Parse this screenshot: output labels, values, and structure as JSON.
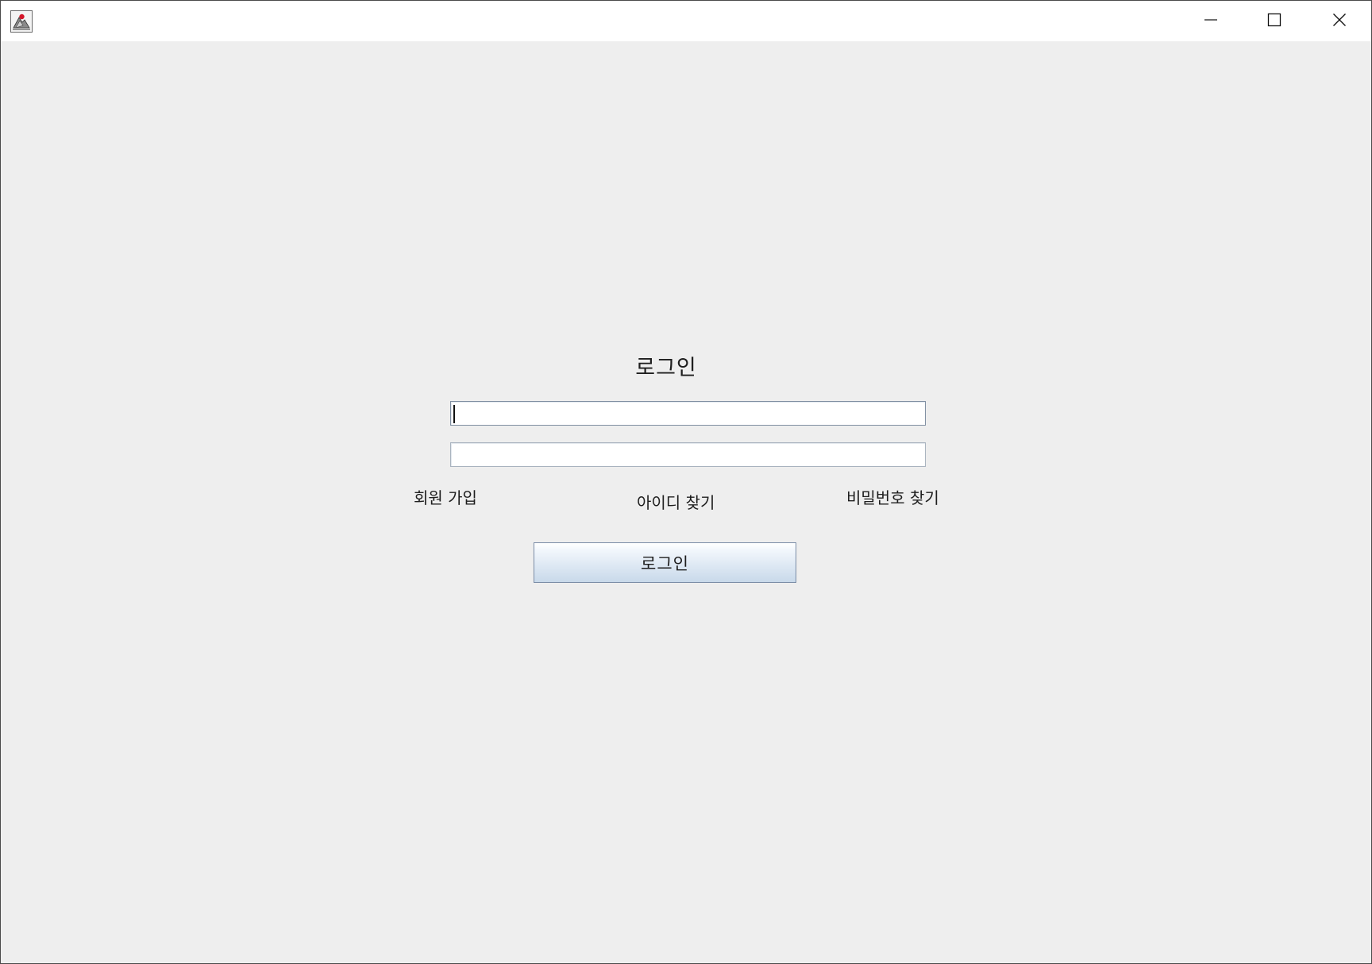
{
  "window": {
    "icon": "java-duke-icon",
    "controls": {
      "minimize_icon": "minimize-icon",
      "maximize_icon": "maximize-icon",
      "close_icon": "close-icon"
    }
  },
  "login": {
    "title": "로그인",
    "id_field": {
      "value": "",
      "placeholder": ""
    },
    "password_field": {
      "value": "",
      "placeholder": ""
    },
    "links": {
      "signup": "회원 가입",
      "find_id": "아이디 찾기",
      "find_password": "비밀번호 찾기"
    },
    "submit_label": "로그인"
  },
  "colors": {
    "background": "#eeeeee",
    "titlebar": "#ffffff",
    "button_gradient_top": "#ffffff",
    "button_gradient_bottom": "#c9d9ea",
    "button_border": "#7a8ca6"
  }
}
